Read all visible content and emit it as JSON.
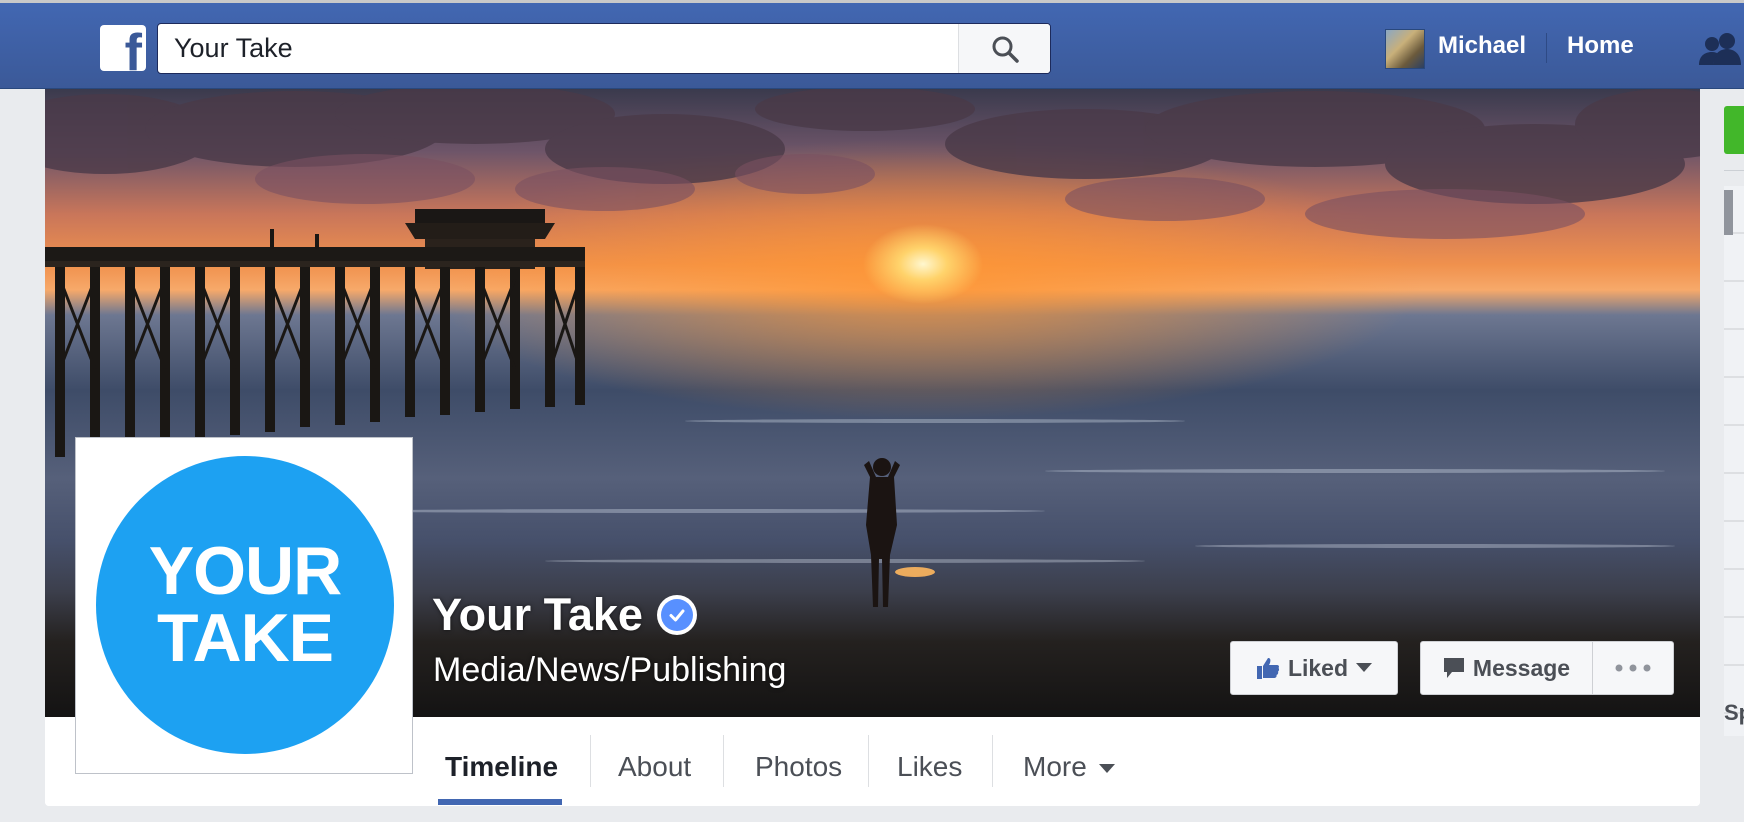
{
  "topbar": {
    "search_value": "Your Take",
    "user_name": "Michael",
    "home_label": "Home"
  },
  "page": {
    "name": "Your Take",
    "category": "Media/News/Publishing",
    "profile_text_line1": "YOUR",
    "profile_text_line2": "TAKE"
  },
  "actions": {
    "liked_label": "Liked",
    "message_label": "Message"
  },
  "tabs": [
    {
      "label": "Timeline",
      "active": true
    },
    {
      "label": "About"
    },
    {
      "label": "Photos"
    },
    {
      "label": "Likes"
    },
    {
      "label": "More"
    }
  ],
  "sidebar_partial_text": "Sp",
  "colors": {
    "brand": "#3b5998",
    "accent": "#4267b2",
    "verified": "#5890ff",
    "profile": "#1da1f2"
  }
}
